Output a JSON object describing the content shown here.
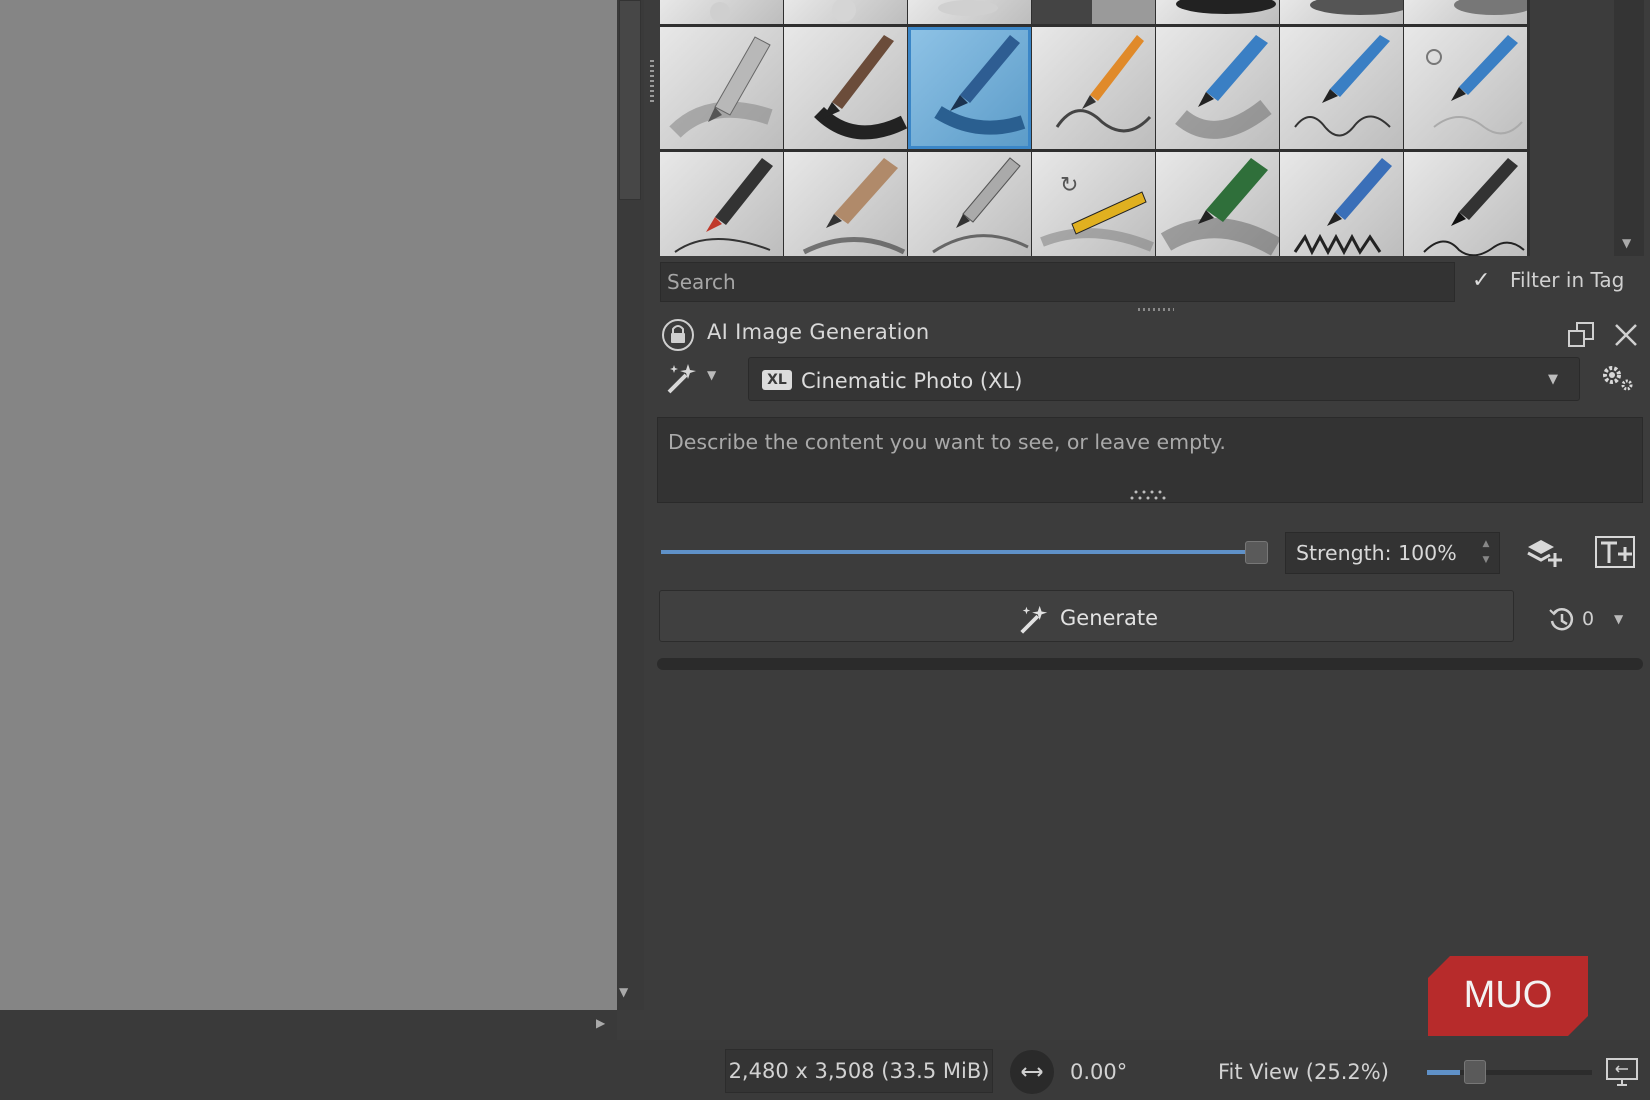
{
  "brush_presets": {
    "selected_index": 2,
    "search_placeholder": "Search",
    "filter_in_tag": {
      "checked": true,
      "check_glyph": "✓",
      "label": "Filter in Tag"
    }
  },
  "docker": {
    "title": "AI Image Generation",
    "style_selector": {
      "badge": "XL",
      "selected": "Cinematic Photo (XL)"
    },
    "prompt_placeholder": "Describe the content you want to see, or leave empty.",
    "strength": {
      "label": "Strength: 100%",
      "value_percent": 100
    },
    "generate_label": "Generate",
    "history_count": "0",
    "colors": {
      "accent": "#5f91c8",
      "panel": "#3c3c3c"
    }
  },
  "status_bar": {
    "dimensions": "2,480 x 3,508 (33.5 MiB)",
    "rotation": "0.00°",
    "zoom": "Fit View (25.2%)",
    "zoom_fraction": 0.2
  },
  "watermark": {
    "text": "MUO",
    "color": "#b72b2b"
  },
  "icons": [
    "lock-icon",
    "float-icon",
    "close-icon",
    "magic-wand-icon",
    "settings-icon",
    "add-layer-icon",
    "add-text-icon",
    "history-icon",
    "monitor-icon",
    "rotate-icon"
  ]
}
